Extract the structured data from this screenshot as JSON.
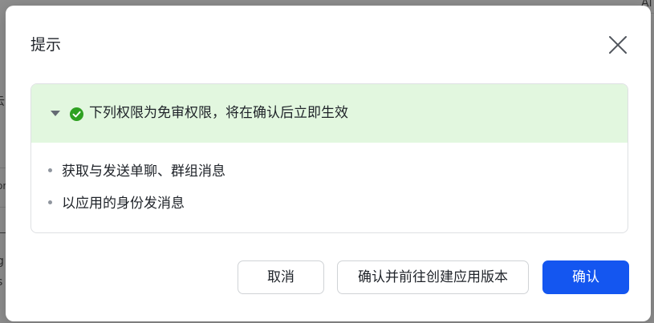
{
  "dialog": {
    "title": "提示",
    "close_icon": "close-icon"
  },
  "permissions": {
    "header": "下列权限为免审权限，将在确认后立即生效",
    "caret_icon": "caret-down-icon",
    "status_icon": "check-circle-icon",
    "status_color": "#2ea121",
    "header_bg": "#e2f7df",
    "items": [
      "获取与发送单聊、群组消息",
      "以应用的身份发消息"
    ]
  },
  "buttons": {
    "cancel": "取消",
    "confirm_and_create": "确认并前往创建应用版本",
    "confirm": "确认",
    "primary_color": "#1456f0"
  },
  "background": {
    "fragments": [
      "Al",
      "云",
      "or",
      "—",
      "g",
      "s"
    ]
  }
}
